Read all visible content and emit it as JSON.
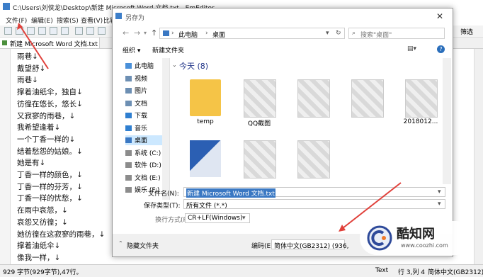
{
  "window": {
    "title": "C:\\Users\\刘侠龙\\Desktop\\新建 Microsoft Word 文档.txt - EmEditor"
  },
  "menu": [
    "文件(F)",
    "编辑(E)",
    "搜索(S)",
    "查看(V)",
    "比较"
  ],
  "toolbar": {
    "filter_label": "筛选"
  },
  "tab": {
    "label": "新建 Microsoft Word 文档.txt"
  },
  "editor_lines": [
    "雨巷↓",
    "戴望舒↓",
    "雨巷↓",
    "撑着油纸伞，独自↓",
    "彷徨在悠长，悠长↓",
    "又寂寥的雨巷，↓",
    "我希望逢着↓",
    "一个丁香一样的↓",
    "结着愁怨的姑娘。↓",
    "她是有↓",
    "丁香一样的颜色，↓",
    "丁香一样的芬芳，↓",
    "丁香一样的忧愁，↓",
    "在雨中哀怨，↓",
    "哀怨又彷徨；↓",
    "她彷徨在这寂寥的雨巷，↓",
    "撑着油纸伞↓",
    "像我一样，↓"
  ],
  "status": {
    "left": "929 字节(929字节),47行。",
    "mode": "Text",
    "position": "行 3,列 4",
    "encoding": "简体中文(GB2312)"
  },
  "dialog": {
    "title": "另存为",
    "close": "✕",
    "breadcrumb": [
      "此电脑",
      "桌面"
    ],
    "search_placeholder": "搜索\"桌面\"",
    "organize": "组织 ▾",
    "new_folder": "新建文件夹",
    "nav_items": [
      {
        "label": "此电脑",
        "color": "#4a90d9"
      },
      {
        "label": "视频",
        "color": "#6d8fb3"
      },
      {
        "label": "图片",
        "color": "#6d8fb3"
      },
      {
        "label": "文档",
        "color": "#6d8fb3"
      },
      {
        "label": "下载",
        "color": "#2f7fd0"
      },
      {
        "label": "音乐",
        "color": "#2f7fd0"
      },
      {
        "label": "桌面",
        "color": "#3a78c3"
      },
      {
        "label": "系统 (C:)",
        "color": "#8c8c8c"
      },
      {
        "label": "软件 (D:)",
        "color": "#8c8c8c"
      },
      {
        "label": "文档 (E:)",
        "color": "#8c8c8c"
      },
      {
        "label": "娱乐 (F:)",
        "color": "#8c8c8c"
      }
    ],
    "group_header": "今天 (8)",
    "files": [
      {
        "name": "temp",
        "kind": "folder"
      },
      {
        "name": "QQ截图",
        "kind": "image"
      },
      {
        "name": "",
        "kind": "image"
      },
      {
        "name": "",
        "kind": "image"
      },
      {
        "name": "2018012...",
        "kind": "image"
      },
      {
        "name": "",
        "kind": "word"
      },
      {
        "name": "",
        "kind": "image"
      },
      {
        "name": "",
        "kind": "image"
      }
    ],
    "filename_label": "文件名(N):",
    "filename_value": "新建 Microsoft Word 文档.txt",
    "filetype_label": "保存类型(T):",
    "filetype_value": "所有文件 (*.*)",
    "linebreak_label": "换行方式(R):",
    "linebreak_value": "CR+LF(Windows)",
    "hide_folders": "隐藏文件夹",
    "encoding_label": "编码(E):",
    "encoding_value": "简体中文(GB2312) (936,"
  },
  "watermark": {
    "name": "酷知网",
    "url": "www.coozhi.com"
  },
  "colors": {
    "accent": "#1e3287",
    "selection": "#cce8ff",
    "arrow": "#e0403a",
    "folder": "#f5c447"
  }
}
